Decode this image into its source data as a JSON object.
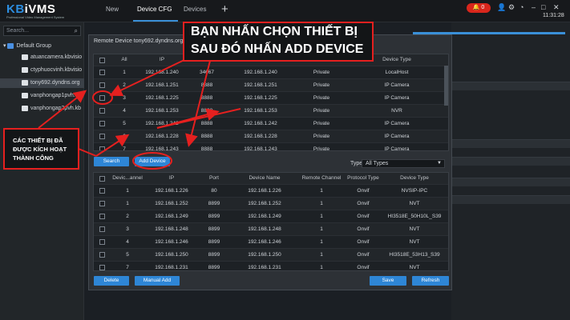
{
  "app": {
    "brand_kb": "KB",
    "brand_rest": "iVMS",
    "tagline": "Professional Video Management System"
  },
  "tabs": [
    {
      "label": "New"
    },
    {
      "label": "Device CFG"
    },
    {
      "label": "Devices"
    }
  ],
  "topbar": {
    "alarm_count": "0",
    "time": "11:31:28"
  },
  "sidebar": {
    "search_placeholder": "Search...",
    "items": [
      {
        "label": "Default Group",
        "type": "group"
      },
      {
        "label": "atuancamera.kbvisio",
        "type": "device"
      },
      {
        "label": "ctyphuocvinh.kbvisio",
        "type": "device"
      },
      {
        "label": "tony692.dyndns.org",
        "type": "device"
      },
      {
        "label": "vanphongap1pvh.dy",
        "type": "device"
      },
      {
        "label": "vanphongap2pvh.kb",
        "type": "device"
      }
    ]
  },
  "dialog": {
    "title": "Remote Device tony692.dyndns.org",
    "top_headers": [
      "All",
      "IP",
      "Port",
      "Device Name",
      "Network Mode",
      "Device Type"
    ],
    "top_rows": [
      [
        "1",
        "192.168.1.240",
        "34667",
        "192.168.1.240",
        "Private",
        "LocalHost"
      ],
      [
        "2",
        "192.168.1.251",
        "8888",
        "192.168.1.251",
        "Private",
        "IP Camera"
      ],
      [
        "3",
        "192.168.1.225",
        "8888",
        "192.168.1.225",
        "Private",
        "IP Camera"
      ],
      [
        "4",
        "192.168.1.253",
        "8888",
        "192.168.1.253",
        "Private",
        "NVR"
      ],
      [
        "5",
        "192.168.1.242",
        "8888",
        "192.168.1.242",
        "Private",
        "IP Camera"
      ],
      [
        "6",
        "192.168.1.228",
        "8888",
        "192.168.1.228",
        "Private",
        "IP Camera"
      ],
      [
        "7",
        "192.168.1.243",
        "8888",
        "192.168.1.243",
        "Private",
        "IP Camera"
      ]
    ],
    "search_btn": "Search",
    "add_btn": "Add Device",
    "type_label": "Type",
    "type_value": "All Types",
    "bottom_headers": [
      "Devic...annel",
      "IP",
      "Port",
      "Device Name",
      "Remote Channel",
      "Protocol Type",
      "Device Type"
    ],
    "bottom_rows": [
      [
        "1",
        "192.168.1.226",
        "80",
        "192.168.1.226",
        "1",
        "Onvif",
        "NVSIP-IPC"
      ],
      [
        "1",
        "192.168.1.252",
        "8899",
        "192.168.1.252",
        "1",
        "Onvif",
        "NVT"
      ],
      [
        "2",
        "192.168.1.249",
        "8899",
        "192.168.1.249",
        "1",
        "Onvif",
        "HI3518E_50H10L_S39"
      ],
      [
        "3",
        "192.168.1.248",
        "8899",
        "192.168.1.248",
        "1",
        "Onvif",
        "NVT"
      ],
      [
        "4",
        "192.168.1.246",
        "8899",
        "192.168.1.246",
        "1",
        "Onvif",
        "NVT"
      ],
      [
        "5",
        "192.168.1.250",
        "8899",
        "192.168.1.250",
        "1",
        "Onvif",
        "HI3518E_53H13_S39"
      ],
      [
        "7",
        "192.168.1.231",
        "8899",
        "192.168.1.231",
        "1",
        "Onvif",
        "NVT"
      ]
    ],
    "delete_btn": "Delete",
    "manual_btn": "Manual Add",
    "save_btn": "Save",
    "refresh_btn": "Refresh"
  },
  "annotations": {
    "top_line1": "BẠN NHẤN CHỌN THIẾT BỊ",
    "top_line2": "SAU ĐÓ NHẤN ADD DEVICE",
    "left_line1": "CÁC THIẾT BỊ ĐÃ",
    "left_line2": "ĐƯỢC KÍCH HOẠT",
    "left_line3": "THÀNH CÔNG"
  },
  "colors": {
    "accent": "#2e86d6",
    "alarm": "#d9261c",
    "annotation": "#e5201f"
  }
}
